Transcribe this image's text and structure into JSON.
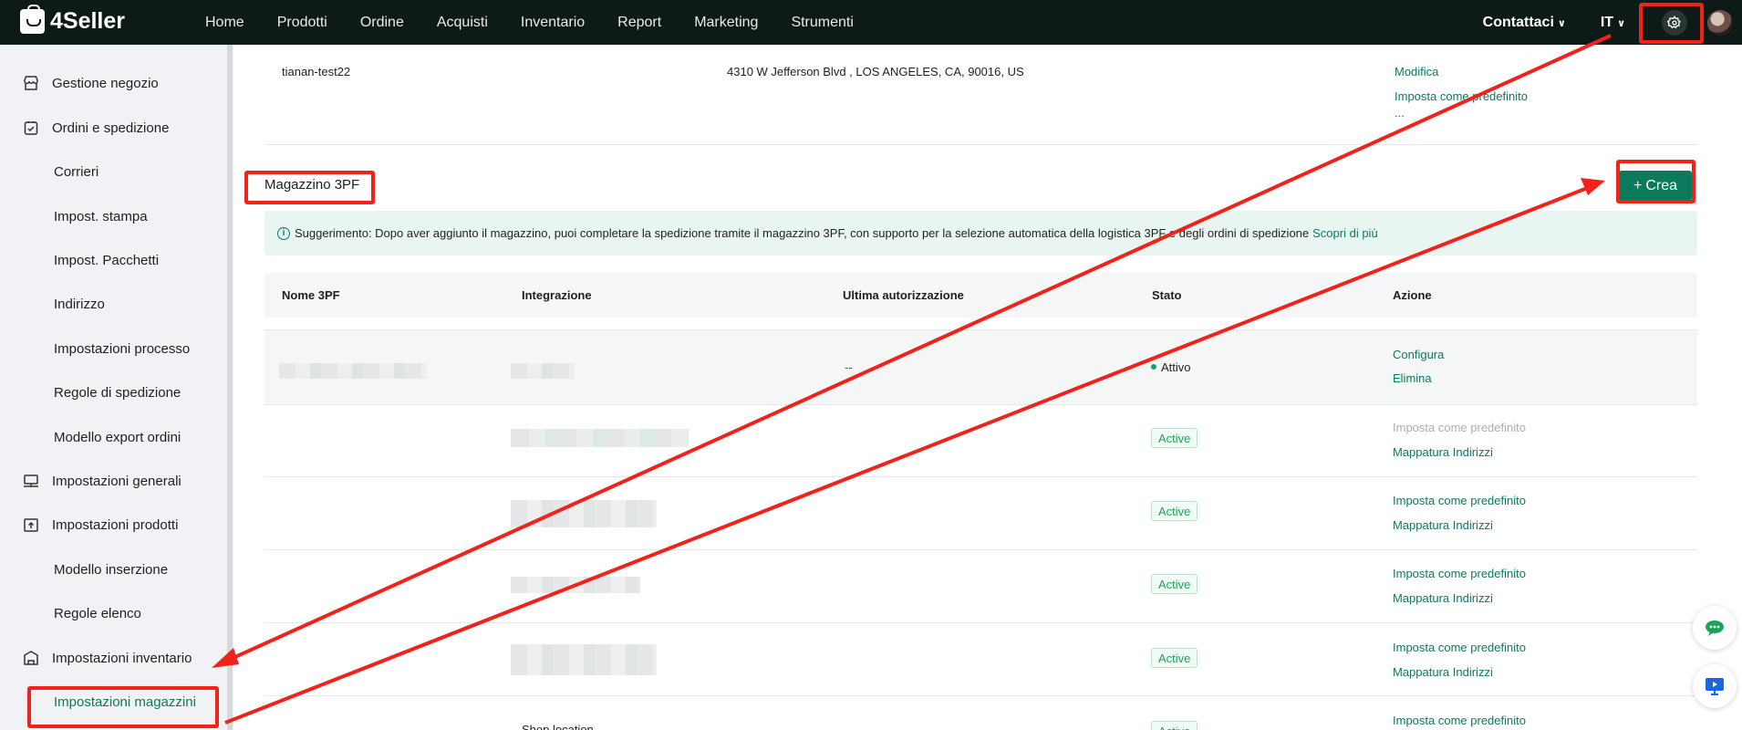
{
  "brand": {
    "name": "4Seller"
  },
  "nav": {
    "items": [
      "Home",
      "Prodotti",
      "Ordine",
      "Acquisti",
      "Inventario",
      "Report",
      "Marketing",
      "Strumenti"
    ],
    "contact": "Contattaci",
    "language": "IT"
  },
  "sidebar": {
    "items": [
      {
        "label": "Gestione negozio",
        "icon": "store-icon"
      },
      {
        "label": "Ordini e spedizione",
        "icon": "clipboard-check-icon"
      },
      {
        "label": "Corrieri"
      },
      {
        "label": "Impost. stampa"
      },
      {
        "label": "Impost. Pacchetti"
      },
      {
        "label": "Indirizzo"
      },
      {
        "label": "Impostazioni processo"
      },
      {
        "label": "Regole di spedizione"
      },
      {
        "label": "Modello export ordini"
      },
      {
        "label": "Impostazioni generali",
        "icon": "monitor-icon"
      },
      {
        "label": "Impostazioni prodotti",
        "icon": "box-upload-icon"
      },
      {
        "label": "Modello inserzione"
      },
      {
        "label": "Regole elenco"
      },
      {
        "label": "Impostazioni inventario",
        "icon": "warehouse-icon"
      },
      {
        "label": "Impostazioni magazzini"
      }
    ]
  },
  "address_row": {
    "name": "tianan-test22",
    "address": "4310 W Jefferson Blvd , LOS ANGELES, CA, 90016, US",
    "actions": [
      "Modifica",
      "Imposta come predefinito",
      "..."
    ]
  },
  "section": {
    "title": "Magazzino 3PF",
    "create_label": "Crea",
    "tip_text": "Suggerimento: Dopo aver aggiunto il magazzino, puoi completare la spedizione tramite il magazzino 3PF, con supporto per la selezione automatica della logistica 3PF e degli ordini di spedizione",
    "tip_link": "Scopri di più"
  },
  "table": {
    "headers": [
      "Nome 3PF",
      "Integrazione",
      "Ultima autorizzazione",
      "Stato",
      "Azione"
    ],
    "row1": {
      "last_auth": "--",
      "status": "Attivo",
      "actions": [
        "Configura",
        "Elimina"
      ]
    },
    "rows": [
      {
        "status": "Active",
        "action_default": "Imposta come predefinito",
        "action_map": "Mappatura Indirizzi"
      },
      {
        "status": "Active",
        "action_default": "Imposta come predefinito",
        "action_map": "Mappatura Indirizzi"
      },
      {
        "status": "Active",
        "action_default": "Imposta come predefinito",
        "action_map": "Mappatura Indirizzi"
      },
      {
        "status": "Active",
        "action_default": "Imposta come predefinito",
        "action_map": "Mappatura Indirizzi"
      }
    ],
    "last_row": {
      "integration": "Shop location",
      "status": "Active",
      "action_default": "Imposta come predefinito"
    }
  },
  "colors": {
    "accent": "#0b7a5c",
    "topbar": "#0e1a17",
    "annotation": "#f0221a",
    "status_green": "#19a35a"
  }
}
